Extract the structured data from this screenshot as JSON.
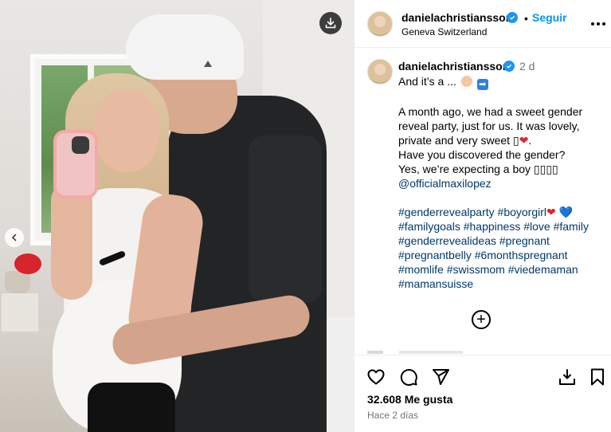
{
  "post": {
    "username": "danielachristiansson",
    "follow_label": "Seguir",
    "separator": "•",
    "location": "Geneva Switzerland",
    "time_ago_short": "2 d",
    "likes": "32.608 Me gusta",
    "posted": "Hace 2 días"
  },
  "caption": {
    "line1": "And it’s a ...",
    "para1_l1": "A month ago, we had a sweet gender",
    "para1_l2": "reveal party, just for us. It was lovely,",
    "para1_l3": "private and very sweet",
    "para1_l4": "Have you discovered the gender?",
    "para1_l5": "Yes, we’re expecting a boy",
    "mention": "@officialmaxilopez",
    "hashtags": [
      "#genderrevealparty",
      "#boyorgirl",
      "#familygoals",
      "#happiness",
      "#love",
      "#family",
      "#genderrevealideas",
      "#pregnant",
      "#pregnantbelly",
      "#6monthspregnant",
      "#momlife",
      "#swissmom",
      "#viedemaman",
      "#mamansuisse"
    ]
  },
  "icons": {
    "download": "download-icon",
    "previous": "chevron-left-icon",
    "verified": "verified-badge-icon",
    "more": "more-options-icon",
    "add_comment": "plus-circle-icon",
    "like": "heart-icon",
    "comment": "comment-icon",
    "share": "send-icon",
    "save_download": "download-icon",
    "bookmark": "bookmark-icon"
  },
  "colors": {
    "link_blue": "#0095f6",
    "hashtag_blue": "#00376b",
    "verified_blue": "#1f95f2",
    "muted_gray": "#737373"
  }
}
